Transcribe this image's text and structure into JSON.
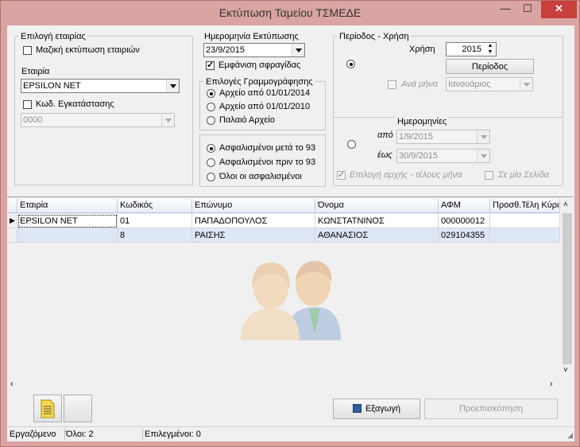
{
  "window": {
    "title": "Εκτύπωση Ταμείου ΤΣΜΕΔΕ"
  },
  "company_group": {
    "label": "Επιλογή εταιρίας",
    "bulk_print_label": "Μαζική εκτύπωση εταιριών",
    "bulk_print_checked": false,
    "company_label": "Εταιρία",
    "company_value": "EPSILON NET",
    "install_code_label": "Κωδ. Εγκατάστασης",
    "install_code_checked": false,
    "install_code_value": "0000"
  },
  "print_date": {
    "label": "Ημερομηνία Εκτύπωσης",
    "value": "23/9/2015",
    "show_stamp_label": "Εμφάνιση σφραγίδας",
    "show_stamp_checked": true
  },
  "registration_options": {
    "label": "Επιλογές Γραμμογράφησης",
    "options": [
      {
        "label": "Αρχείο από 01/01/2014",
        "selected": true
      },
      {
        "label": "Αρχείο από 01/01/2010",
        "selected": false
      },
      {
        "label": "Παλαιό Αρχείο",
        "selected": false
      }
    ]
  },
  "insured_options": [
    {
      "label": "Ασφαλισμένοι μετά το 93",
      "selected": true
    },
    {
      "label": "Ασφαλισμένοι πριν το 93",
      "selected": false
    },
    {
      "label": "Όλοι οι ασφαλισμένοι",
      "selected": false
    }
  ],
  "period_group": {
    "label": "Περίοδος - Χρήση",
    "year_label": "Χρήση",
    "year_value": "2015",
    "period_button": "Περίοδος",
    "monthly_label": "Ανά μήνα",
    "month_value": "Ιανουάριος"
  },
  "dates_group": {
    "label": "Ημερομηνίες",
    "from_label": "από",
    "from_value": "1/9/2015",
    "to_label": "έως",
    "to_value": "30/9/2015",
    "month_start_end_label": "Επιλογή αρχής - τέλους μήνα",
    "month_start_end_checked": true,
    "single_page_label": "Σε μία Σελίδα",
    "single_page_checked": false
  },
  "table": {
    "columns": [
      "Εταιρία",
      "Κωδικός",
      "Επώνυμο",
      "Όνομα",
      "ΑΦΜ",
      "Προσθ.Τέλη Κύριας"
    ],
    "rows": [
      [
        "EPSILON NET",
        "01",
        "ΠΑΠΑΔΟΠΟΥΛΟΣ",
        "ΚΩΝΣΤΑΤΝΙΝΟΣ",
        "000000012",
        ""
      ],
      [
        "",
        "8",
        "ΡΑΙΣΗΣ",
        "ΑΘΑΝΑΣΙΟΣ",
        "029104355",
        ""
      ]
    ]
  },
  "toolbar": {
    "export_label": "Εξαγωγή",
    "preview_label": "Προεπισκόπηση"
  },
  "statusbar": {
    "working": "Εργαζόμενο",
    "total": "Όλοι: 2",
    "selected": "Επιλεγμένοι: 0"
  },
  "colors": {
    "window_frame": "#d9a4a1",
    "close_button": "#c7403c",
    "selected_row": "#dde7f5"
  }
}
